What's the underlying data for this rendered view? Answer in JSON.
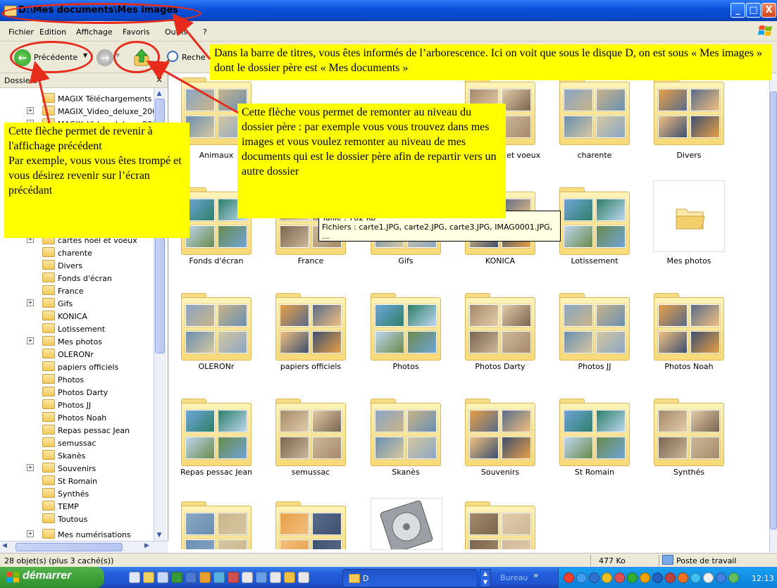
{
  "window": {
    "title": "D:\\Mes documents\\Mes images",
    "minimize": "_",
    "maximize": "□",
    "close": "X"
  },
  "menu": [
    "Fichier",
    "Edition",
    "Affichage",
    "Favoris",
    "Outils",
    "?"
  ],
  "toolbar": {
    "back_label": "Précédente",
    "search_label": "Reche"
  },
  "left_panel": {
    "header": "Dossiers",
    "close": "×",
    "items": [
      {
        "label": "MAGIX Téléchargements",
        "plus": false
      },
      {
        "label": "MAGIX_Video_deluxe_2008",
        "plus": true
      },
      {
        "label": "MAGIX_Video_deluxe_2008",
        "plus": true
      },
      {
        "label": "cartes noel et voeux",
        "plus": true
      },
      {
        "label": "charente",
        "plus": false
      },
      {
        "label": "Divers",
        "plus": false
      },
      {
        "label": "Fonds d'écran",
        "plus": false
      },
      {
        "label": "France",
        "plus": false
      },
      {
        "label": "Gifs",
        "plus": true
      },
      {
        "label": "KONICA",
        "plus": false
      },
      {
        "label": "Lotissement",
        "plus": false
      },
      {
        "label": "Mes photos",
        "plus": true
      },
      {
        "label": "OLERONr",
        "plus": false
      },
      {
        "label": "papiers officiels",
        "plus": false
      },
      {
        "label": "Photos",
        "plus": false
      },
      {
        "label": "Photos Darty",
        "plus": false
      },
      {
        "label": "Photos JJ",
        "plus": false
      },
      {
        "label": "Photos Noah",
        "plus": false
      },
      {
        "label": "Repas pessac Jean",
        "plus": false
      },
      {
        "label": "semussac",
        "plus": false
      },
      {
        "label": "Skanès",
        "plus": false
      },
      {
        "label": "Souvenirs",
        "plus": true
      },
      {
        "label": "St Romain",
        "plus": false
      },
      {
        "label": "Synthés",
        "plus": false
      },
      {
        "label": "TEMP",
        "plus": false
      },
      {
        "label": "Toutous",
        "plus": false
      },
      {
        "label": "Mes numérisations",
        "plus": true
      }
    ]
  },
  "folders": {
    "row1": [
      "Animaux",
      "",
      "",
      "Cartes noel et voeux",
      "charente",
      "Divers"
    ],
    "row2": [
      "Fonds d'écran",
      "France",
      "Gifs",
      "KONICA",
      "Lotissement",
      "Mes photos"
    ],
    "row3": [
      "OLERONr",
      "papiers officiels",
      "Photos",
      "Photos Darty",
      "Photos JJ",
      "Photos Noah"
    ],
    "row4": [
      "Repas pessac Jean",
      "semussac",
      "Skanès",
      "Souvenirs",
      "St Romain",
      "Synthés"
    ]
  },
  "tooltip": {
    "line1": "Taille : 782 Ko",
    "line2": "Fichiers : carte1.JPG, carte2.JPG, carte3.JPG, IMAG0001.JPG, ..."
  },
  "status": {
    "objects": "28 objet(s) (plus 3 caché(s))",
    "size": "477 Ko",
    "location": "Poste de travail"
  },
  "taskbar": {
    "start": "démarrer",
    "task_label": "D",
    "bureau": "Bureau",
    "clock": "12:13"
  },
  "notes": {
    "titlebar": "Dans la barre de titres, vous êtes informés  de l’arborescence. Ici on voit que sous le disque D, on est sous « Mes images » dont le dossier père est  « Mes documents »",
    "up": "Cette flèche vous permet de remonter au niveau du dossier père : par exemple vous vous trouvez dans mes images et vous voulez remonter au niveau de mes documents qui est le dossier père afin de repartir vers un autre dossier",
    "back": "Cette flèche permet de revenir à l'affichage précédent\nPar exemple, vous vous êtes trompé et vous désirez revenir sur l’écran précédant"
  },
  "colors": {
    "annotation_yellow": "#ffff00",
    "annotation_red": "#e82c1c",
    "xp_blue": "#0a4fd8",
    "xp_start_green": "#2f8f2a"
  }
}
